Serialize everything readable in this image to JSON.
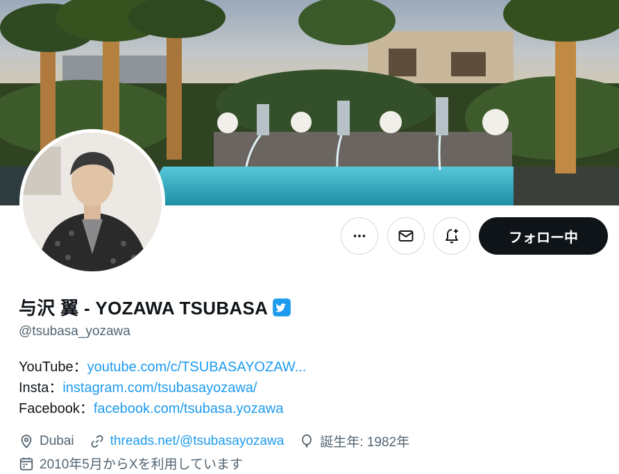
{
  "profile": {
    "display_name": "与沢 翼 - YOZAWA TSUBASA",
    "handle": "@tsubasa_yozawa",
    "verified": true
  },
  "actions": {
    "more_icon": "more-icon",
    "message_icon": "mail-icon",
    "notify_icon": "bell-plus-icon",
    "follow_label": "フォロー中"
  },
  "bio": {
    "youtube_label": "YouTube：",
    "youtube_link": "youtube.com/c/TSUBASAYOZAW...",
    "insta_label": "Insta：",
    "insta_link": "instagram.com/tsubasayozawa/",
    "facebook_label": "Facebook：",
    "facebook_link": "facebook.com/tsubasa.yozawa"
  },
  "meta": {
    "location": "Dubai",
    "website": "threads.net/@tsubasayozawa",
    "birth": "誕生年: 1982年",
    "joined": "2010年5月からXを利用しています"
  },
  "colors": {
    "link": "#1d9bf0",
    "secondary_text": "#536471",
    "verified_badge": "#1d9bf0",
    "follow_button": "#0f1419"
  }
}
